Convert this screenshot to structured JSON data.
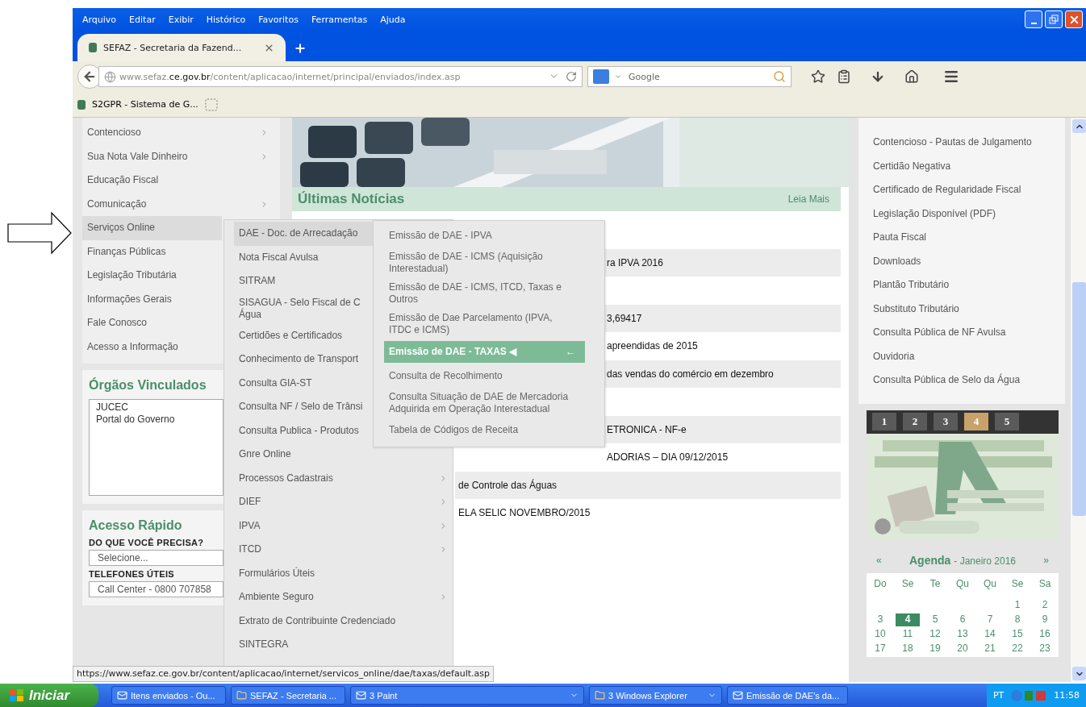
{
  "menu_bar": [
    "Arquivo",
    "Editar",
    "Exibir",
    "Histórico",
    "Favoritos",
    "Ferramentas",
    "Ajuda"
  ],
  "tabs": [
    {
      "label": "SEFAZ - Secretaria da Fazend...",
      "selected": true
    }
  ],
  "address_bar": {
    "url_parts": [
      "www.sefaz.",
      "ce.gov.br",
      "/content/aplicacao/internet/principal/enviados/index.asp"
    ]
  },
  "search_field": {
    "placeholder": "Google"
  },
  "bookmarks": [
    {
      "label": "S2GPR - Sistema de G..."
    }
  ],
  "sidebar": {
    "items": [
      {
        "label": "Contencioso",
        "has_submenu": true,
        "selected": false
      },
      {
        "label": "Sua Nota Vale Dinheiro",
        "has_submenu": true,
        "selected": false
      },
      {
        "label": "Educação Fiscal",
        "has_submenu": false,
        "selected": false
      },
      {
        "label": "Comunicação",
        "has_submenu": true,
        "selected": false
      },
      {
        "label": "Serviços Online",
        "has_submenu": false,
        "selected": true
      },
      {
        "label": "Finanças Públicas",
        "has_submenu": false,
        "selected": false
      },
      {
        "label": "Legislação Tributária",
        "has_submenu": false,
        "selected": false
      },
      {
        "label": "Informações Gerais",
        "has_submenu": false,
        "selected": false
      },
      {
        "label": "Fale Conosco",
        "has_submenu": false,
        "selected": false
      },
      {
        "label": "Acesso a Informação",
        "has_submenu": false,
        "selected": false
      }
    ]
  },
  "submenu": {
    "items": [
      {
        "label": "DAE - Doc. de Arrecadação",
        "selected": true
      },
      {
        "label": "Nota Fiscal Avulsa",
        "selected": false
      },
      {
        "label": "SITRAM",
        "selected": false
      },
      {
        "label": "SISAGUA - Selo Fiscal de C\nÁgua",
        "selected": false
      },
      {
        "label": "Certidões e Certificados",
        "selected": false
      },
      {
        "label": "Conhecimento de Transport",
        "selected": false
      },
      {
        "label": "Consulta GIA-ST",
        "selected": false
      },
      {
        "label": "Consulta NF / Selo de Trânsi",
        "selected": false
      },
      {
        "label": "Consulta Publica - Produtos",
        "selected": false
      },
      {
        "label": "Gnre Online",
        "has_submenu": false,
        "selected": false
      },
      {
        "label": "Processos Cadastrais",
        "has_submenu": true,
        "selected": false
      },
      {
        "label": "DIEF",
        "has_submenu": true,
        "selected": false
      },
      {
        "label": "IPVA",
        "has_submenu": true,
        "selected": false
      },
      {
        "label": "ITCD",
        "has_submenu": true,
        "selected": false
      },
      {
        "label": "Formulários Úteis",
        "has_submenu": false,
        "selected": false
      },
      {
        "label": "Ambiente Seguro",
        "has_submenu": true,
        "selected": false
      },
      {
        "label": "Extrato de Contribuinte Credenciado",
        "has_submenu": false,
        "selected": false
      },
      {
        "label": "SINTEGRA",
        "has_submenu": false,
        "selected": false
      }
    ]
  },
  "flyout": {
    "items": [
      {
        "label": "Emissão de DAE - IPVA",
        "selected": false
      },
      {
        "label": "Emissão de DAE - ICMS (Aquisição Interestadual)",
        "selected": false
      },
      {
        "label": "Emissão de DAE - ICMS, ITCD, Taxas e Outros",
        "selected": false
      },
      {
        "label": "Emissão de Dae Parcelamento (IPVA, ITDC e ICMS)",
        "selected": false
      },
      {
        "label": "Emissão de DAE - TAXAS ◀",
        "selected": true,
        "marker": "←"
      },
      {
        "label": "Consulta de Recolhimento",
        "selected": false
      },
      {
        "label": "Consulta Situação de DAE de Mercadoria Adquirida em Operação Interestadual",
        "selected": false
      },
      {
        "label": "Tabela de Códigos de Receita",
        "selected": false
      }
    ]
  },
  "orgaos": {
    "title": "Órgãos Vinculados",
    "options": [
      "JUCEC",
      "Portal do Governo"
    ]
  },
  "acesso": {
    "title": "Acesso Rápido",
    "fields": [
      {
        "label": "DO QUE VOCÊ PRECISA?",
        "value": "Selecione..."
      },
      {
        "label": "TELEFONES ÚTEIS",
        "value": "Call Center - 0800 707858"
      }
    ]
  },
  "news": {
    "title": "Últimas Notícias",
    "more": "Leia Mais",
    "rows": [
      {
        "shaded": false
      },
      {
        "shaded": true,
        "text": "ra IPVA 2016"
      },
      {
        "shaded": false
      },
      {
        "shaded": true,
        "text": "3,69417"
      },
      {
        "shaded": false,
        "text": "apreendidas de 2015"
      },
      {
        "shaded": true,
        "text": "das vendas do comércio em dezembro"
      },
      {
        "shaded": false
      },
      {
        "shaded": true,
        "text": "ETRONICA - NF-e"
      },
      {
        "shaded": false,
        "text": "ADORIAS – DIA 09/12/2015"
      },
      {
        "shaded": true,
        "text": "de Controle das Águas"
      },
      {
        "shaded": false,
        "text": "ELA SELIC NOVEMBRO/2015"
      }
    ]
  },
  "links": [
    "Contencioso - Pautas de Julgamento",
    "Certidão Negativa",
    "Certificado de Regularidade Fiscal",
    "Legislação Disponível (PDF)",
    "Pauta Fiscal",
    "Downloads",
    "Plantão Tributário",
    "Substituto Tributário",
    "Consulta Pública de NF Avulsa",
    "Ouvidoria",
    "Consulta Pública de Selo da Água"
  ],
  "slider": {
    "pages": [
      {
        "label": "1",
        "selected": false
      },
      {
        "label": "2",
        "selected": false
      },
      {
        "label": "3",
        "selected": false
      },
      {
        "label": "4",
        "selected": true
      },
      {
        "label": "5",
        "selected": false
      }
    ]
  },
  "agenda": {
    "prev": "«",
    "title": "Agenda",
    "subtitle": "- Janeiro 2016",
    "next": "»",
    "weekdays": [
      "Do",
      "Se",
      "Te",
      "Qu",
      "Qu",
      "Se",
      "Sa"
    ],
    "weeks": [
      [
        {
          "day": "1",
          "selected": false
        },
        {
          "day": "2",
          "selected": false
        }
      ],
      [
        {
          "day": "3",
          "selected": false
        },
        {
          "day": "4",
          "selected": true
        },
        {
          "day": "5",
          "selected": false
        },
        {
          "day": "6",
          "selected": false
        },
        {
          "day": "7",
          "selected": false
        },
        {
          "day": "8",
          "selected": false
        },
        {
          "day": "9",
          "selected": false
        }
      ],
      [
        {
          "day": "10",
          "selected": false
        },
        {
          "day": "11",
          "selected": false
        },
        {
          "day": "12",
          "selected": false
        },
        {
          "day": "13",
          "selected": false
        },
        {
          "day": "14",
          "selected": false
        },
        {
          "day": "15",
          "selected": false
        },
        {
          "day": "16",
          "selected": false
        }
      ],
      [
        {
          "day": "17",
          "selected": false
        },
        {
          "day": "18",
          "selected": false
        },
        {
          "day": "19",
          "selected": false
        },
        {
          "day": "20",
          "selected": false
        },
        {
          "day": "21",
          "selected": false
        },
        {
          "day": "22",
          "selected": false
        },
        {
          "day": "23",
          "selected": false
        }
      ]
    ]
  },
  "status_bar": {
    "text": "https://www.sefaz.ce.gov.br/content/aplicacao/internet/servicos_online/dae/taxas/default.asp"
  },
  "taskbar": {
    "start": "Iniciar",
    "tasks": [
      {
        "label": "Itens enviados - Ou..."
      },
      {
        "label": "SEFAZ - Secretaria ..."
      },
      {
        "label": "3 Paint",
        "grouped": true
      },
      {
        "label": "3 Windows Explorer",
        "grouped": true
      },
      {
        "label": "Emissão de DAE's da..."
      }
    ],
    "language": "PT",
    "clock": "11:58"
  }
}
